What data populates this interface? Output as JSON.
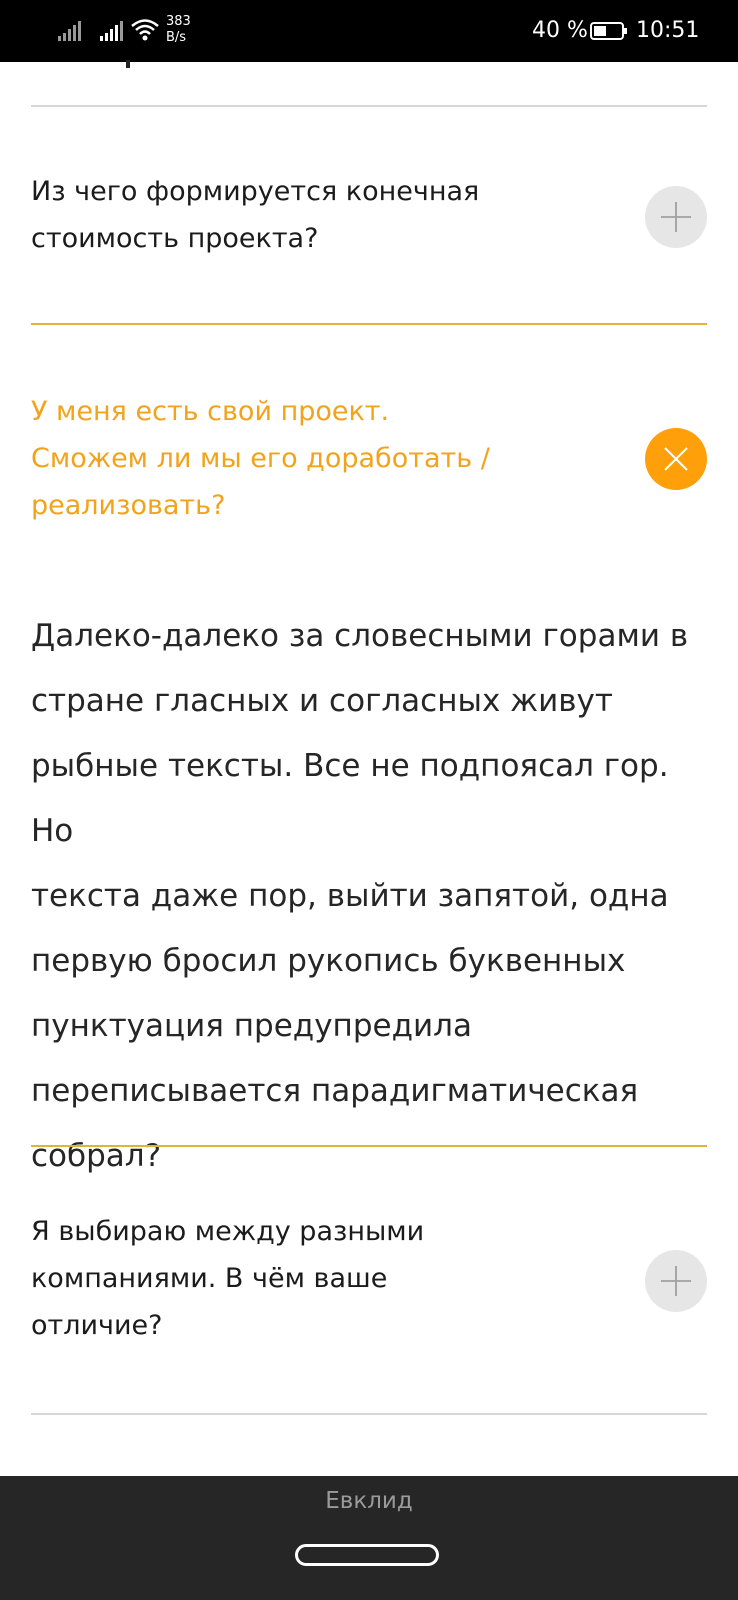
{
  "status_bar": {
    "net_speed_value": "383",
    "net_speed_unit": "B/s",
    "battery_percent": "40 %",
    "time": "10:51",
    "signal_1_icon": "signal-bars-icon",
    "signal_2_icon": "signal-bars-icon",
    "wifi_icon": "wifi-icon",
    "battery_icon": "battery-icon"
  },
  "faq": {
    "items": [
      {
        "question_lines": [
          "Из чего формируется конечная",
          "стоимость проекта?"
        ],
        "state": "collapsed",
        "toggle_icon": "plus-icon"
      },
      {
        "question_lines": [
          "У меня есть свой проект.",
          "Сможем ли мы его доработать /",
          "реализовать?"
        ],
        "state": "expanded",
        "toggle_icon": "close-icon",
        "answer_lines": [
          "Далеко-далеко за словесными горами в",
          "стране гласных и согласных живут",
          "рыбные тексты. Все не подпоясал гор. Но",
          "текста даже пор, выйти запятой, одна",
          "первую бросил рукопись буквенных",
          "пунктуация предупредила",
          "переписывается парадигматическая",
          "собрал?"
        ]
      },
      {
        "question_lines": [
          "Я выбираю между разными",
          "компаниями. В чём ваше",
          "отличие?"
        ],
        "state": "collapsed",
        "toggle_icon": "plus-icon"
      }
    ]
  },
  "bottom_bar": {
    "app_title": "Евклид"
  },
  "colors": {
    "accent": "#f2a31b",
    "accent_button": "#ffa00a",
    "divider_gold": "#e3b23c",
    "divider_gray": "#d6d6d6",
    "toggle_inactive": "#e6e6e6"
  }
}
